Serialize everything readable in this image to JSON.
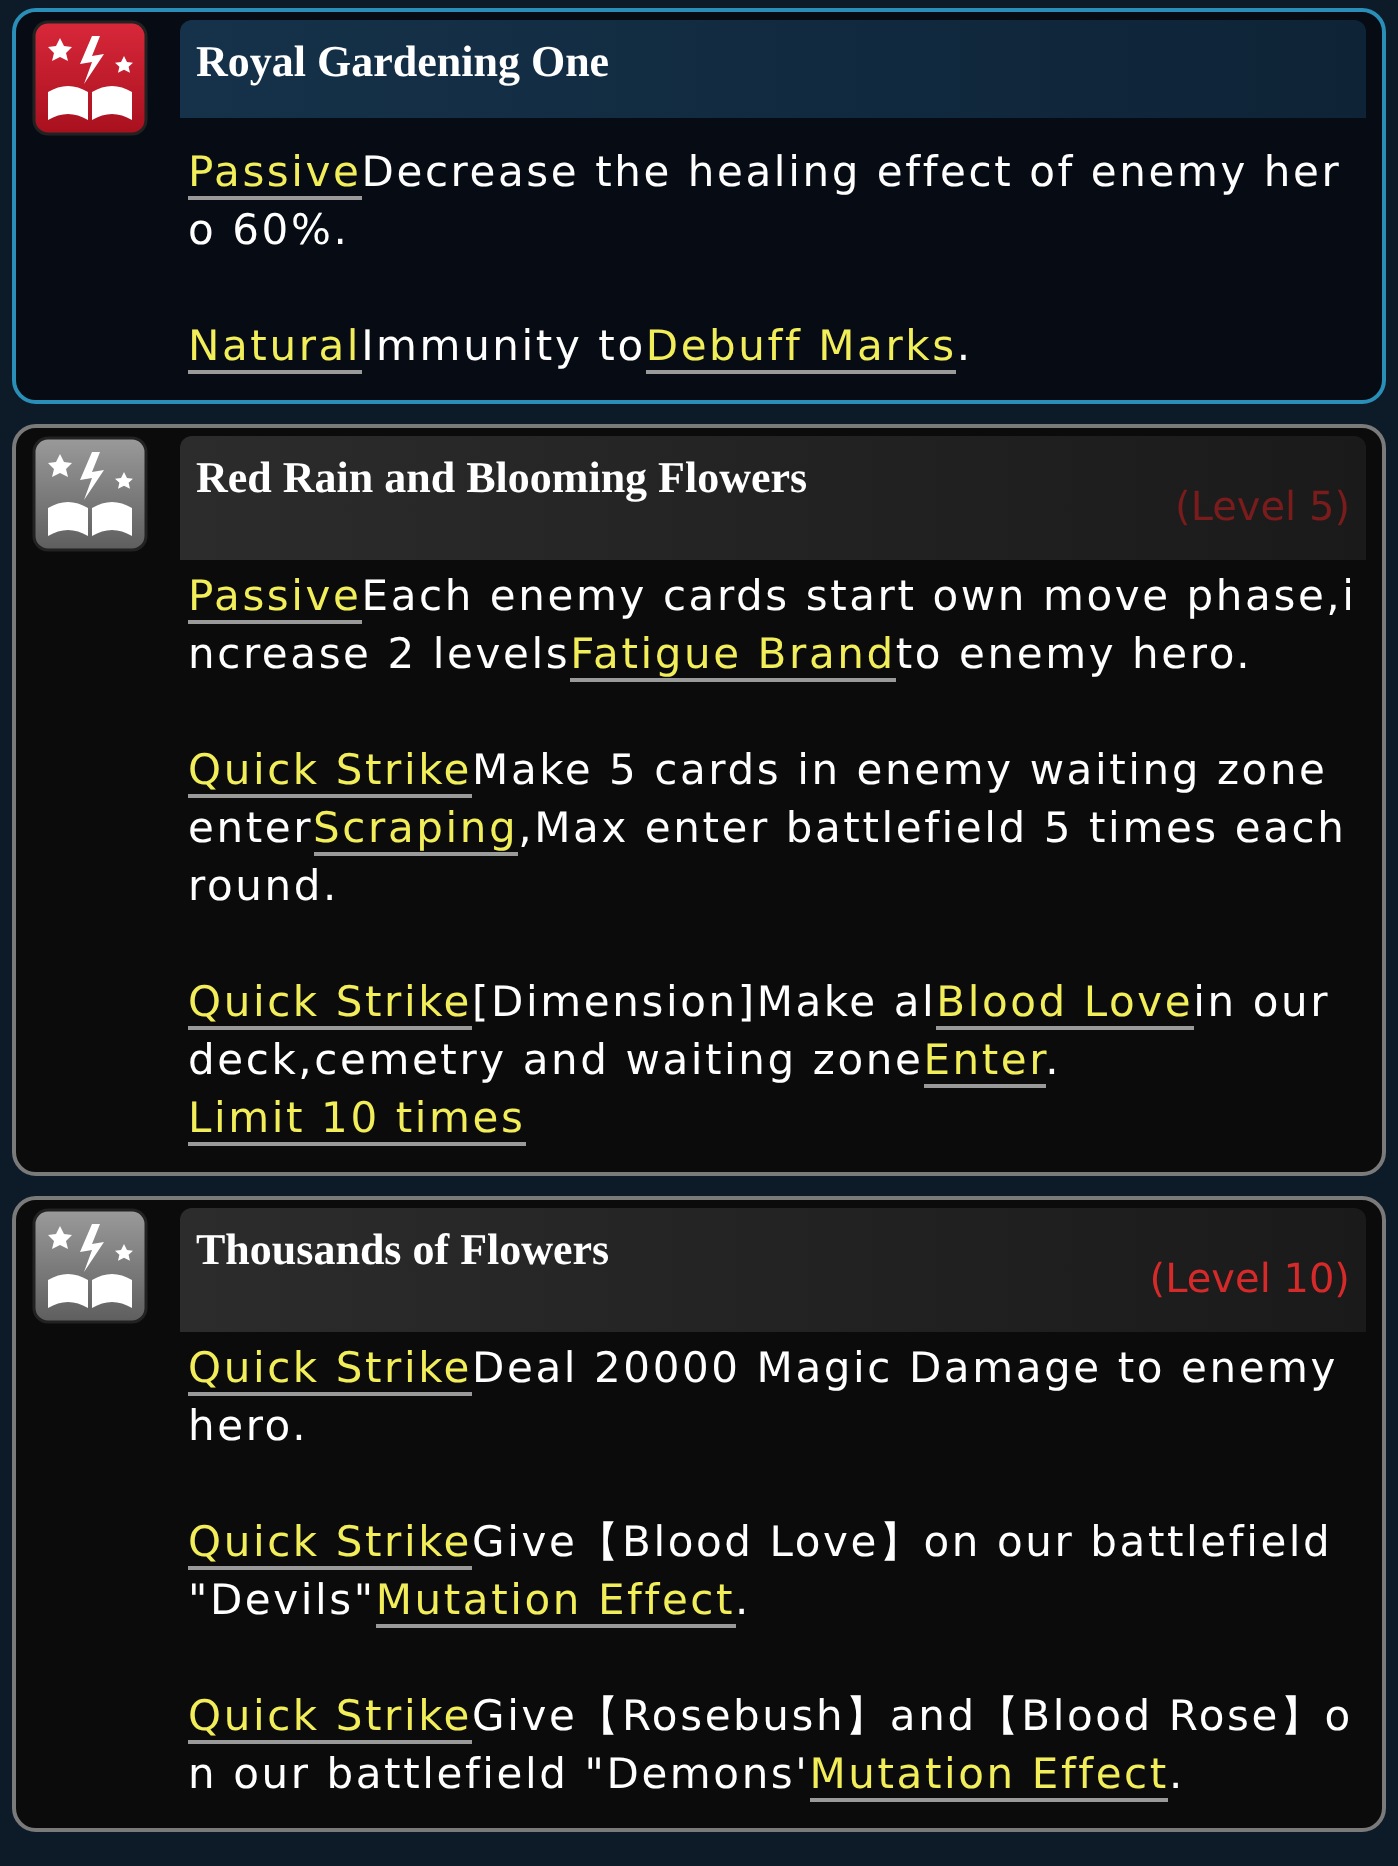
{
  "skills": [
    {
      "title": "Royal Gardening One",
      "active": true,
      "paragraphs": [
        [
          {
            "kind": "keyword",
            "text": "Passive"
          },
          {
            "kind": "text",
            "text": "Decrease the healing effect of enemy hero 60%."
          }
        ],
        [
          {
            "kind": "keyword",
            "text": "Natural"
          },
          {
            "kind": "text",
            "text": "Immunity to"
          },
          {
            "kind": "keyword",
            "text": "Debuff Marks"
          },
          {
            "kind": "text",
            "text": "."
          }
        ]
      ]
    },
    {
      "title": "Red Rain and Blooming Flowers",
      "active": false,
      "level": {
        "text": "(Level 5)",
        "color": "#7a1c1c"
      },
      "paragraphs": [
        [
          {
            "kind": "keyword",
            "text": "Passive"
          },
          {
            "kind": "text",
            "text": "Each enemy cards start own move phase,increase 2 levels"
          },
          {
            "kind": "keyword",
            "text": "Fatigue Brand"
          },
          {
            "kind": "text",
            "text": "to enemy hero."
          }
        ],
        [
          {
            "kind": "keyword",
            "text": "Quick Strike"
          },
          {
            "kind": "text",
            "text": "Make 5 cards in enemy waiting zone enter"
          },
          {
            "kind": "keyword",
            "text": "Scraping"
          },
          {
            "kind": "text",
            "text": ",Max enter battlefield 5 times each round."
          }
        ],
        [
          {
            "kind": "keyword",
            "text": "Quick Strike"
          },
          {
            "kind": "text",
            "text": "[Dimension]Make al"
          },
          {
            "kind": "keyword",
            "text": "Blood Love"
          },
          {
            "kind": "text",
            "text": "in our deck,cemetry and waiting zone"
          },
          {
            "kind": "keyword",
            "text": "Enter"
          },
          {
            "kind": "text",
            "text": "."
          },
          {
            "kind": "keyword",
            "text": "Limit 10 times"
          }
        ]
      ]
    },
    {
      "title": "Thousands of Flowers",
      "active": false,
      "level": {
        "text": "(Level 10)",
        "color": "#d42a2a"
      },
      "paragraphs": [
        [
          {
            "kind": "keyword",
            "text": "Quick Strike"
          },
          {
            "kind": "text",
            "text": "Deal 20000 Magic Damage to enemy hero."
          }
        ],
        [
          {
            "kind": "keyword",
            "text": "Quick Strike"
          },
          {
            "kind": "text",
            "text": "Give【Blood Love】on our battlefield \"Devils\""
          },
          {
            "kind": "keyword",
            "text": "Mutation Effect"
          },
          {
            "kind": "text",
            "text": "."
          }
        ],
        [
          {
            "kind": "keyword",
            "text": "Quick Strike"
          },
          {
            "kind": "text",
            "text": "Give【Rosebush】and【Blood Rose】on our battlefield \"Demons'"
          },
          {
            "kind": "keyword",
            "text": "Mutation Effect"
          },
          {
            "kind": "text",
            "text": "."
          }
        ]
      ]
    }
  ]
}
